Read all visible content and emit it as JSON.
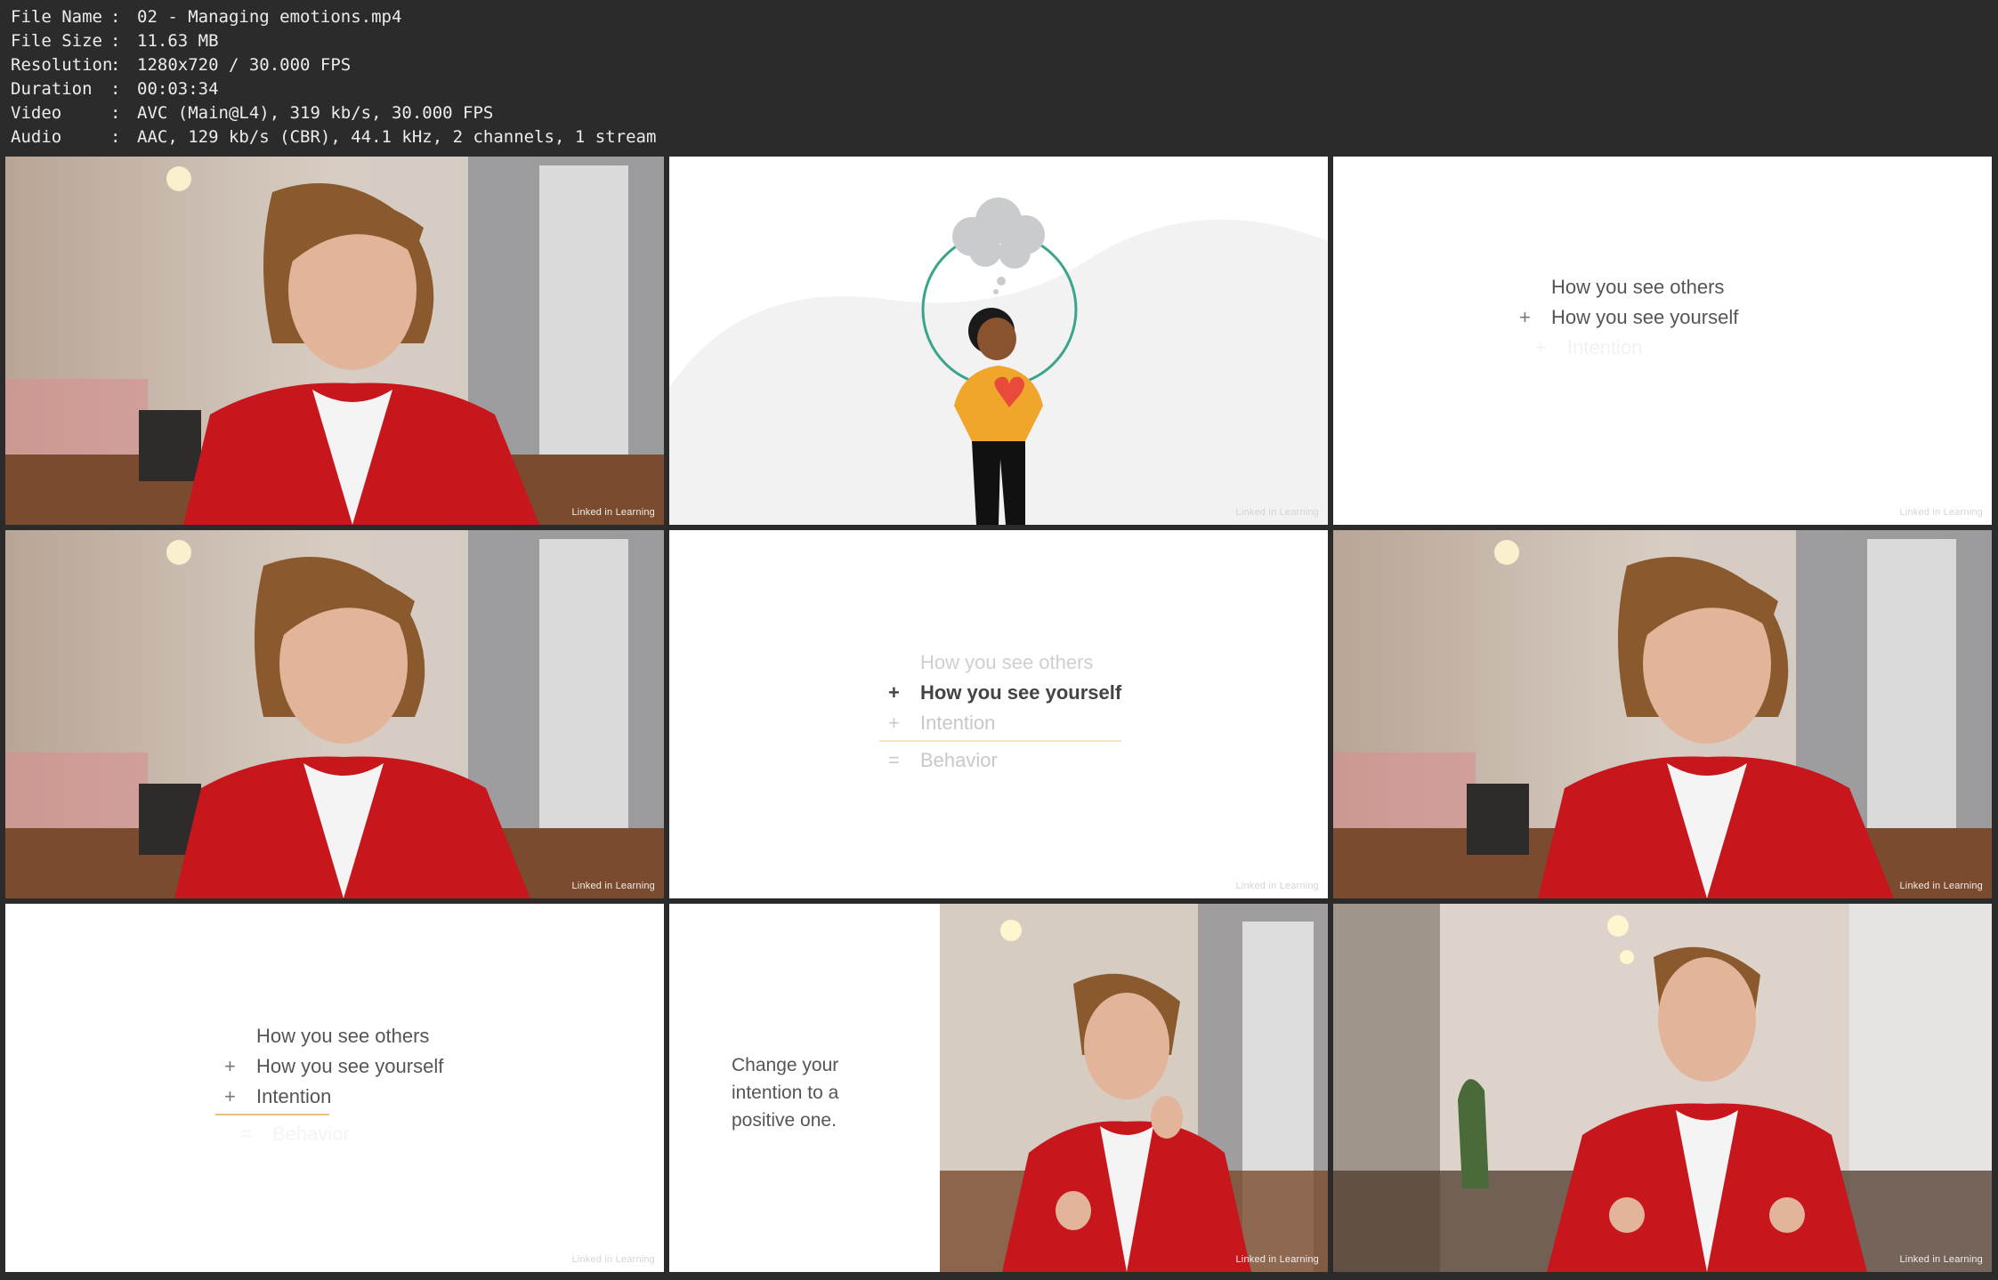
{
  "info": {
    "rows": [
      {
        "key": "File Name",
        "value": "02 - Managing emotions.mp4"
      },
      {
        "key": "File Size",
        "value": "11.63 MB"
      },
      {
        "key": "Resolution",
        "value": "1280x720 / 30.000 FPS"
      },
      {
        "key": "Duration",
        "value": "00:03:34"
      },
      {
        "key": "Video",
        "value": "AVC (Main@L4), 319 kb/s, 30.000 FPS"
      },
      {
        "key": "Audio",
        "value": "AAC, 129 kb/s (CBR), 44.1 kHz, 2 channels, 1 stream"
      }
    ],
    "separator": ":"
  },
  "watermark": "Linked in Learning",
  "slides": {
    "s3": {
      "l1": "How you see others",
      "op2": "+",
      "l2": "How you see yourself",
      "op3": "+",
      "l3": "Intention"
    },
    "s5": {
      "l1": "How you see others",
      "op2": "+",
      "l2": "How you see yourself",
      "op3": "+",
      "l3": "Intention",
      "op4": "=",
      "l4": "Behavior"
    },
    "s7": {
      "l1": "How you see others",
      "op2": "+",
      "l2": "How you see yourself",
      "op3": "+",
      "l3": "Intention",
      "op4": "=",
      "l4": "Behavior"
    },
    "s8": {
      "text_lines": [
        "Change your",
        "intention to a",
        "positive one."
      ]
    }
  },
  "colors": {
    "background": "#2b2b2b",
    "jacket": "#c8161d",
    "accent_line": "#e7c27d",
    "circle": "#3aa58a"
  }
}
